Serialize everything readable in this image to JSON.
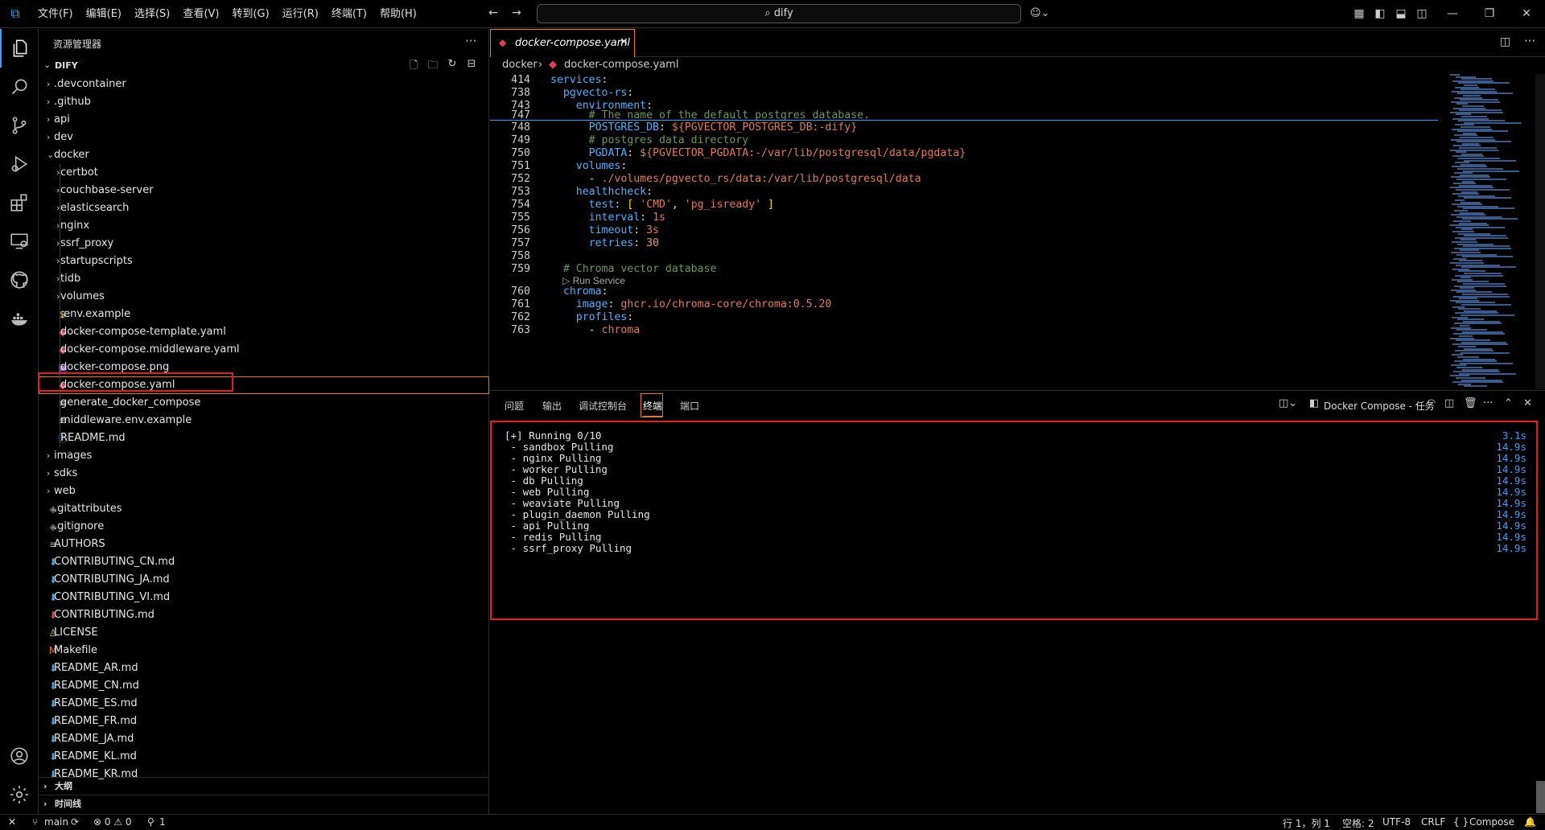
{
  "titlebar": {
    "menus": [
      "文件(F)",
      "编辑(E)",
      "选择(S)",
      "查看(V)",
      "转到(G)",
      "运行(R)",
      "终端(T)",
      "帮助(H)"
    ],
    "search_text": "dify"
  },
  "sidebar": {
    "title": "资源管理器",
    "root": "DIFY",
    "tree": [
      {
        "label": ".devcontainer",
        "type": "folder",
        "depth": 0
      },
      {
        "label": ".github",
        "type": "folder",
        "depth": 0
      },
      {
        "label": "api",
        "type": "folder",
        "depth": 0
      },
      {
        "label": "dev",
        "type": "folder",
        "depth": 0
      },
      {
        "label": "docker",
        "type": "folder-open",
        "depth": 0
      },
      {
        "label": "certbot",
        "type": "folder",
        "depth": 1
      },
      {
        "label": "couchbase-server",
        "type": "folder",
        "depth": 1
      },
      {
        "label": "elasticsearch",
        "type": "folder",
        "depth": 1
      },
      {
        "label": "nginx",
        "type": "folder",
        "depth": 1
      },
      {
        "label": "ssrf_proxy",
        "type": "folder",
        "depth": 1
      },
      {
        "label": "startupscripts",
        "type": "folder",
        "depth": 1
      },
      {
        "label": "tidb",
        "type": "folder",
        "depth": 1
      },
      {
        "label": "volumes",
        "type": "folder",
        "depth": 1
      },
      {
        "label": ".env.example",
        "type": "env",
        "depth": 1
      },
      {
        "label": "docker-compose-template.yaml",
        "type": "docker",
        "depth": 1
      },
      {
        "label": "docker-compose.middleware.yaml",
        "type": "docker",
        "depth": 1
      },
      {
        "label": "docker-compose.png",
        "type": "image",
        "depth": 1
      },
      {
        "label": "docker-compose.yaml",
        "type": "docker",
        "depth": 1,
        "selected": true
      },
      {
        "label": "generate_docker_compose",
        "type": "text",
        "depth": 1
      },
      {
        "label": "middleware.env.example",
        "type": "text",
        "depth": 1
      },
      {
        "label": "README.md",
        "type": "info",
        "depth": 1
      },
      {
        "label": "images",
        "type": "folder",
        "depth": 0
      },
      {
        "label": "sdks",
        "type": "folder",
        "depth": 0
      },
      {
        "label": "web",
        "type": "folder",
        "depth": 0
      },
      {
        "label": ".gitattributes",
        "type": "git",
        "depth": 0
      },
      {
        "label": ".gitignore",
        "type": "git",
        "depth": 0
      },
      {
        "label": "AUTHORS",
        "type": "text",
        "depth": 0
      },
      {
        "label": "CONTRIBUTING_CN.md",
        "type": "md",
        "depth": 0
      },
      {
        "label": "CONTRIBUTING_JA.md",
        "type": "md",
        "depth": 0
      },
      {
        "label": "CONTRIBUTING_VI.md",
        "type": "md",
        "depth": 0
      },
      {
        "label": "CONTRIBUTING.md",
        "type": "md-red",
        "depth": 0
      },
      {
        "label": "LICENSE",
        "type": "license",
        "depth": 0
      },
      {
        "label": "Makefile",
        "type": "make",
        "depth": 0
      },
      {
        "label": "README_AR.md",
        "type": "md",
        "depth": 0
      },
      {
        "label": "README_CN.md",
        "type": "md",
        "depth": 0
      },
      {
        "label": "README_ES.md",
        "type": "md",
        "depth": 0
      },
      {
        "label": "README_FR.md",
        "type": "md",
        "depth": 0
      },
      {
        "label": "README_JA.md",
        "type": "md",
        "depth": 0
      },
      {
        "label": "README_KL.md",
        "type": "md",
        "depth": 0
      },
      {
        "label": "README_KR.md",
        "type": "md",
        "depth": 0
      }
    ],
    "sections": [
      "大纲",
      "时间线"
    ]
  },
  "editor": {
    "tab_label": "docker-compose.yaml",
    "breadcrumb": [
      "docker",
      "docker-compose.yaml"
    ],
    "codelens": "Run Service",
    "lines": [
      {
        "n": "414",
        "html": "<span class='k'>services</span>:"
      },
      {
        "n": "738",
        "html": "  <span class='k'>pgvecto-rs</span>:"
      },
      {
        "n": "743",
        "html": "    <span class='k'>environment</span>:"
      },
      {
        "n": "747",
        "html": "      <span class='c'># The name of the default postgres database.</span>"
      },
      {
        "n": "748",
        "html": "      <span class='k'>POSTGRES_DB</span>: <span class='s'>${PGVECTOR_POSTGRES_DB:-dify}</span>"
      },
      {
        "n": "749",
        "html": "      <span class='c'># postgres data directory</span>"
      },
      {
        "n": "750",
        "html": "      <span class='k'>PGDATA</span>: <span class='s'>${PGVECTOR_PGDATA:-/var/lib/postgresql/data/pgdata}</span>"
      },
      {
        "n": "751",
        "html": "    <span class='k'>volumes</span>:"
      },
      {
        "n": "752",
        "html": "      - <span class='s'>./volumes/pgvecto_rs/data:/var/lib/postgresql/data</span>"
      },
      {
        "n": "753",
        "html": "    <span class='k'>healthcheck</span>:"
      },
      {
        "n": "754",
        "html": "      <span class='k'>test</span>: <span class='p'>[</span> <span class='s'>'CMD'</span>, <span class='s'>'pg_isready'</span> <span class='p'>]</span>"
      },
      {
        "n": "755",
        "html": "      <span class='k'>interval</span>: <span class='s'>1s</span>"
      },
      {
        "n": "756",
        "html": "      <span class='k'>timeout</span>: <span class='s'>3s</span>"
      },
      {
        "n": "757",
        "html": "      <span class='k'>retries</span>: <span class='v'>30</span>"
      },
      {
        "n": "758",
        "html": ""
      },
      {
        "n": "759",
        "html": "  <span class='c'># Chroma vector database</span>"
      },
      {
        "n": "760",
        "html": "  <span class='k'>chroma</span>:"
      },
      {
        "n": "761",
        "html": "    <span class='k'>image</span>: <span class='s'>ghcr.io/chroma-core/chroma:0.5.20</span>"
      },
      {
        "n": "762",
        "html": "    <span class='k'>profiles</span>:"
      },
      {
        "n": "763",
        "html": "      - <span class='s'>chroma</span>"
      }
    ]
  },
  "panel": {
    "tabs": [
      "问题",
      "输出",
      "调试控制台",
      "终端",
      "端口"
    ],
    "active_tab": "终端",
    "terminal_name": "Docker Compose - 任务",
    "terminal": [
      {
        "text": "[+] Running 0/10",
        "time": "3.1s"
      },
      {
        "text": " - sandbox Pulling",
        "time": "14.9s"
      },
      {
        "text": " - nginx Pulling",
        "time": "14.9s"
      },
      {
        "text": " - worker Pulling",
        "time": "14.9s"
      },
      {
        "text": " - db Pulling",
        "time": "14.9s"
      },
      {
        "text": " - web Pulling",
        "time": "14.9s"
      },
      {
        "text": " - weaviate Pulling",
        "time": "14.9s"
      },
      {
        "text": " - plugin_daemon Pulling",
        "time": "14.9s"
      },
      {
        "text": " - api Pulling",
        "time": "14.9s"
      },
      {
        "text": " - redis Pulling",
        "time": "14.9s"
      },
      {
        "text": " - ssrf_proxy Pulling",
        "time": "14.9s"
      }
    ]
  },
  "statusbar": {
    "branch": "main",
    "problems": "⊗ 0 ⚠ 0",
    "ports": "1",
    "position": "行 1，列 1",
    "spaces": "空格: 2",
    "encoding": "UTF-8",
    "eol": "CRLF",
    "language": "Compose"
  },
  "colors": {
    "accent": "#3c9cff",
    "highlight": "#e02020",
    "selection": "#e07b2b"
  }
}
